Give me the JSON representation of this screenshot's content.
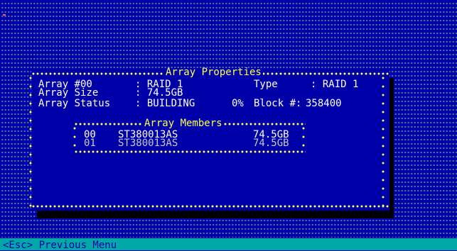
{
  "dialog": {
    "title": "Array Properties",
    "array_label": "Array #00",
    "array_value": ": RAID 1",
    "type_label": "Type",
    "type_value": ": RAID 1",
    "size_label": "Array Size",
    "size_value": ": 74.5GB",
    "status_label": "Array Status",
    "status_value": ": BUILDING",
    "progress_text": "0%",
    "block_label": "Block #:",
    "block_value": "358400"
  },
  "members": {
    "title": "Array Members",
    "rows": [
      {
        "id": "00",
        "model": "ST380013AS",
        "size": "74.5GB"
      },
      {
        "id": "01",
        "model": "ST380013AS",
        "size": "74.5GB"
      }
    ]
  },
  "footer": {
    "hint": "<Esc> Previous Menu"
  },
  "colors": {
    "background": "#0000a8",
    "dialog_border": "#ffff55",
    "text": "#ffffff",
    "footer_bar": "#00a8a8",
    "footer_text": "#0000a8",
    "pattern_dots": "#4b6f9c"
  }
}
